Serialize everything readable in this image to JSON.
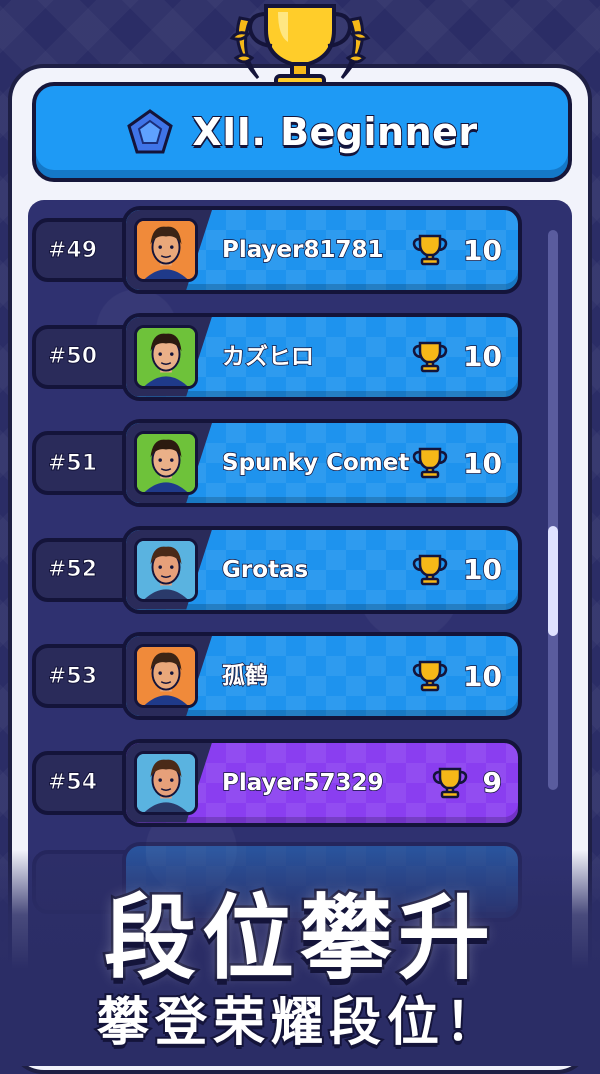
{
  "league": {
    "title": "XII. Beginner"
  },
  "leaderboard": [
    {
      "rank": "#49",
      "name": "Player81781",
      "score": "10",
      "style": "blue",
      "skin": "#e9a87a",
      "hair": "#3b2415",
      "shirt": "#1f3a8a",
      "bg": "#f08a3a"
    },
    {
      "rank": "#50",
      "name": "カズヒロ",
      "score": "10",
      "style": "blue",
      "skin": "#eab088",
      "hair": "#2b1a10",
      "shirt": "#1f3a8a",
      "bg": "#6ec23a"
    },
    {
      "rank": "#51",
      "name": "Spunky Comet",
      "score": "10",
      "style": "blue",
      "skin": "#eab088",
      "hair": "#2b1a10",
      "shirt": "#1f3a8a",
      "bg": "#6ec23a"
    },
    {
      "rank": "#52",
      "name": "Grotas",
      "score": "10",
      "style": "blue",
      "skin": "#e6a07a",
      "hair": "#4a2a18",
      "shirt": "#2a3a6a",
      "bg": "#5ab3e0"
    },
    {
      "rank": "#53",
      "name": "孤鹤",
      "score": "10",
      "style": "blue",
      "skin": "#e9a87a",
      "hair": "#3b2415",
      "shirt": "#1f3a8a",
      "bg": "#f08a3a"
    },
    {
      "rank": "#54",
      "name": "Player57329",
      "score": "9",
      "style": "purple",
      "skin": "#e6a07a",
      "hair": "#4a2a18",
      "shirt": "#2a3a6a",
      "bg": "#5ab3e0"
    }
  ],
  "promo": {
    "headline": "段位攀升",
    "subline": "攀登荣耀段位！"
  },
  "colors": {
    "accent_blue": "#1e93ee",
    "own_row_purple": "#8a3ef0",
    "trophy_gold": "#f6b818",
    "background": "#2b2d66"
  },
  "icons": {
    "header": "golden-trophy-icon",
    "rank": "blue-pentagon-gem-icon",
    "score": "small-trophy-icon"
  }
}
